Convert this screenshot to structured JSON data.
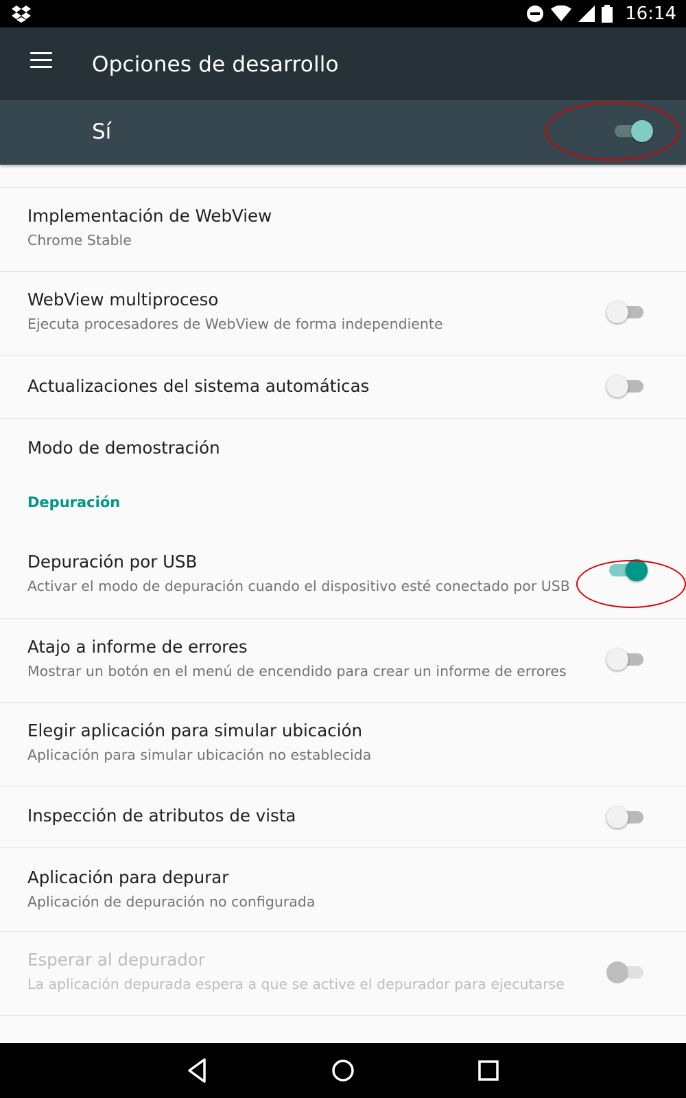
{
  "status_bar": {
    "time": "16:14",
    "icons": [
      "dropbox-icon",
      "do-not-disturb-icon",
      "wifi-icon",
      "signal-icon",
      "battery-icon"
    ]
  },
  "app_bar": {
    "title": "Opciones de desarrollo",
    "menu_icon": "hamburger-menu-icon"
  },
  "master_switch": {
    "label": "Sí",
    "state": "on"
  },
  "settings": [
    {
      "title": "Implementación de WebView",
      "summary": "Chrome Stable"
    },
    {
      "title": "WebView multiproceso",
      "summary": "Ejecuta procesadores de WebView de forma independiente",
      "toggle": "off"
    },
    {
      "title": "Actualizaciones del sistema automáticas",
      "toggle": "off"
    },
    {
      "title": "Modo de demostración"
    }
  ],
  "section_header": "Depuración",
  "debug_settings": [
    {
      "title": "Depuración por USB",
      "summary": "Activar el modo de depuración cuando el dispositivo esté conectado por USB",
      "toggle": "on"
    },
    {
      "title": "Atajo a informe de errores",
      "summary": "Mostrar un botón en el menú de encendido para crear un informe de errores",
      "toggle": "off"
    },
    {
      "title": "Elegir aplicación para simular ubicación",
      "summary": "Aplicación para simular ubicación no establecida"
    },
    {
      "title": "Inspección de atributos de vista",
      "toggle": "off"
    },
    {
      "title": "Aplicación para depurar",
      "summary": "Aplicación de depuración no configurada"
    },
    {
      "title": "Esperar al depurador",
      "summary": "La aplicación depurada espera a que se active el depurador para ejecutarse",
      "toggle": "off",
      "disabled": true
    }
  ],
  "nav_bar": {
    "buttons": [
      "back-icon",
      "home-icon",
      "recents-icon"
    ]
  },
  "colors": {
    "accent": "#009688",
    "app_bar": "#263238",
    "master_bar": "#37474f",
    "annotation": "#d80000"
  }
}
